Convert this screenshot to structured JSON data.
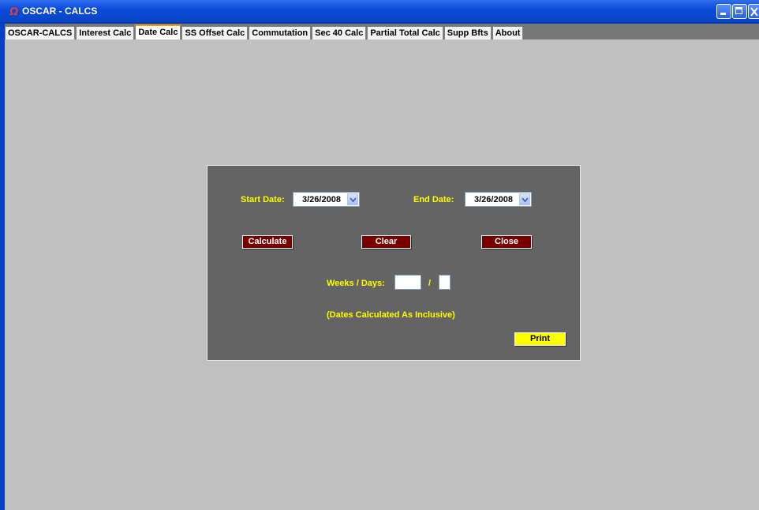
{
  "window": {
    "title": "OSCAR - CALCS",
    "app_icon_glyph": "Ω"
  },
  "tabs": [
    {
      "label": "OSCAR-CALCS",
      "active": false
    },
    {
      "label": "Interest Calc",
      "active": false
    },
    {
      "label": "Date Calc",
      "active": true
    },
    {
      "label": "SS Offset Calc",
      "active": false
    },
    {
      "label": "Commutation",
      "active": false
    },
    {
      "label": "Sec 40 Calc",
      "active": false
    },
    {
      "label": "Partial Total Calc",
      "active": false
    },
    {
      "label": "Supp Bfts",
      "active": false
    },
    {
      "label": "About",
      "active": false
    }
  ],
  "date_calc": {
    "start_date_label": "Start Date:",
    "start_date_value": "3/26/2008",
    "end_date_label": "End Date:",
    "end_date_value": "3/26/2008",
    "calculate_label": "Calculate",
    "clear_label": "Clear",
    "close_label": "Close",
    "weeks_days_label": "Weeks / Days:",
    "weeks_value": "",
    "days_value": "",
    "separator": "/",
    "note": "(Dates Calculated As Inclusive)",
    "print_label": "Print"
  },
  "colors": {
    "titlebar": "#0a4ad8",
    "panel_bg": "#646464",
    "label_text": "#ffff00",
    "action_button": "#7a0000",
    "print_button": "#ffff00",
    "active_tab_accent": "#f0a000"
  }
}
